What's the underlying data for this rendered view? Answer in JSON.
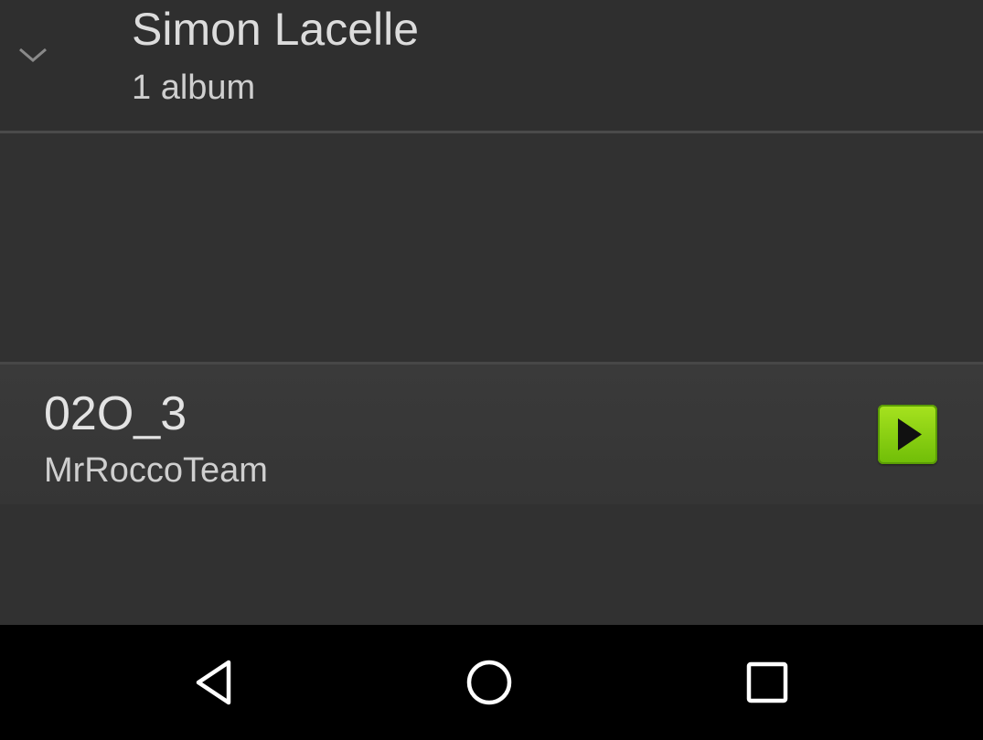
{
  "artist_header": {
    "artist_name": "Simon Lacelle",
    "album_count": "1 album",
    "collapse_icon": "chevron-down-icon"
  },
  "track": {
    "title": "02O_3",
    "artist": "MrRoccoTeam",
    "play_icon": "play-icon",
    "play_color": "#8fd212"
  },
  "nav_bar": {
    "back_icon": "back-triangle-icon",
    "home_icon": "home-circle-icon",
    "recents_icon": "recents-square-icon"
  },
  "colors": {
    "background": "#313131",
    "text_primary": "#e3e3e3",
    "nav_background": "#000000"
  }
}
